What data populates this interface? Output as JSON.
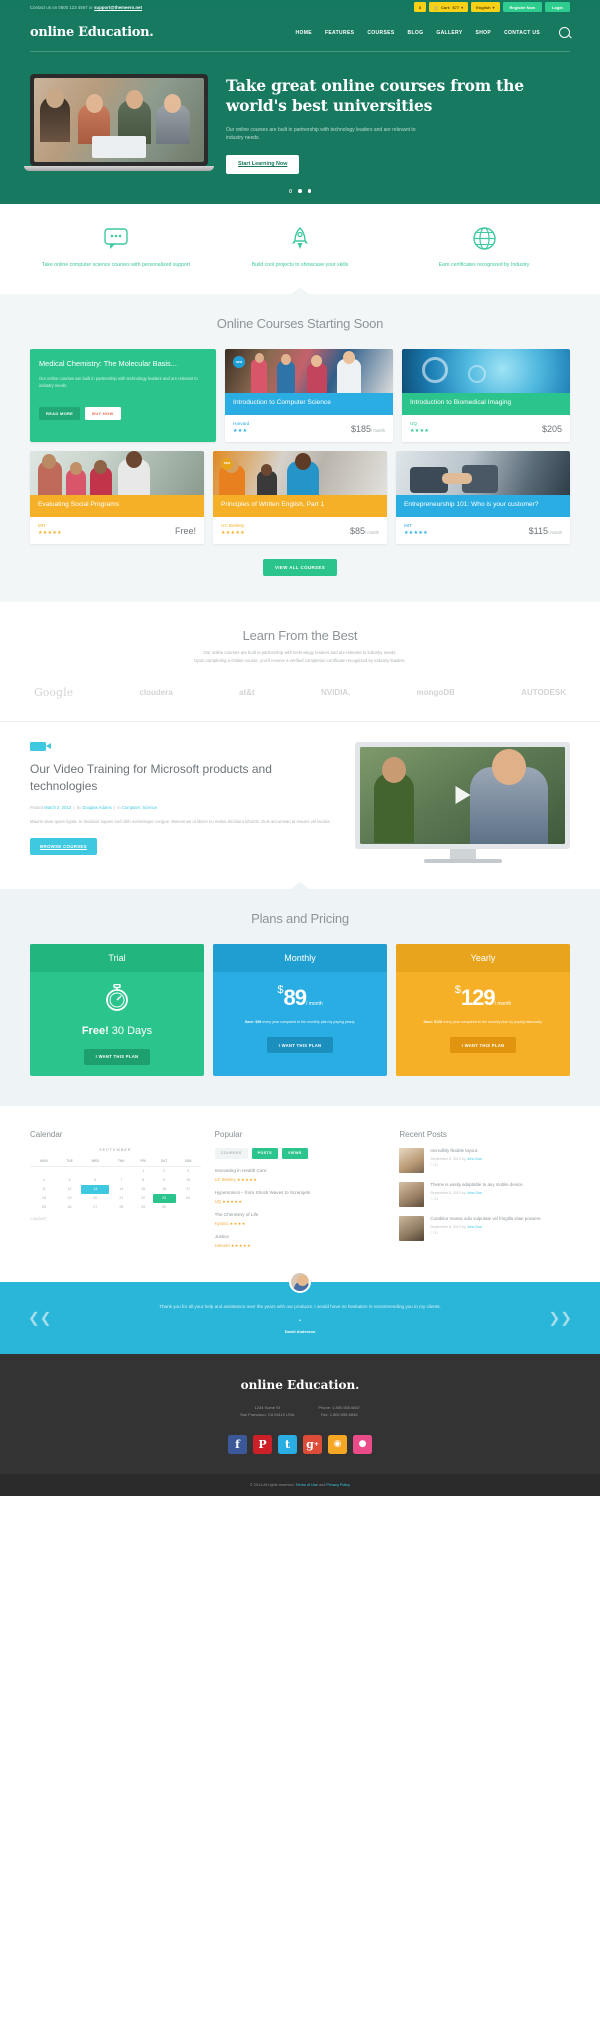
{
  "topbar": {
    "contact_prefix": "Contact us on 0800 123 4567 or",
    "contact_email": "support@themeero.net",
    "currency": "$",
    "cart_label": "Cart:",
    "cart_amount": "$77",
    "language": "English",
    "register": "Register Now",
    "login": "Login"
  },
  "header": {
    "logo": "online Education.",
    "nav": [
      "HOME",
      "FEATURES",
      "COURSES",
      "BLOG",
      "GALLERY",
      "SHOP",
      "CONTACT US"
    ],
    "search_icon": "search-icon"
  },
  "hero": {
    "heading": "Take great online courses from the world's best universities",
    "paragraph": "Our online courses are built in partnership with technology leaders and are relevant to industry needs.",
    "cta": "Start Learning Now",
    "slide_count": 3,
    "active_slide": 1
  },
  "features": [
    {
      "icon": "chat-bubble-icon",
      "text": "Take online computer science courses with personalized support"
    },
    {
      "icon": "rocket-icon",
      "text": "Build cool projects to showcase your skills"
    },
    {
      "icon": "globe-icon",
      "text": "Earn certificates recognized by Industry"
    }
  ],
  "courses": {
    "title": "Online Courses Starting Soon",
    "promo": {
      "title": "Medical Chemistry: The Molecular Basis...",
      "body": "Our online courses are built in partnership with technology leaders and are relevant to industry needs.",
      "btn_read": "READ MORE",
      "btn_buy": "BUY NOW"
    },
    "items": [
      {
        "title": "Introduction to Computer Science",
        "university": "Harvard",
        "rating": 3,
        "price": "$185",
        "per": "/ month",
        "color": "#29ade3",
        "badge": "NEW",
        "badge_color": "#1f9fd6",
        "img": "students-reading"
      },
      {
        "title": "Introduction to Biomedical Imaging",
        "university": "UQ",
        "rating": 4,
        "price": "$205",
        "per": "",
        "color": "#2bc48c",
        "badge": "",
        "badge_color": "",
        "img": "microscope-blue"
      },
      {
        "title": "Evaluating Social Programs",
        "university": "MIT",
        "rating": 5,
        "price": "Free!",
        "per": "",
        "color": "#f5b027",
        "badge": "",
        "badge_color": "",
        "img": "family-group"
      },
      {
        "title": "Principles of Written English, Part 1",
        "university": "UC Berkley",
        "rating": 5,
        "price": "$85",
        "per": "/ month",
        "color": "#f5b027",
        "badge": "NEW",
        "badge_color": "#e8a21c",
        "img": "classroom-orange"
      },
      {
        "title": "Entrepreneurship 101: Who is your customer?",
        "university": "MIT",
        "rating": 5,
        "price": "$115",
        "per": "/ month",
        "color": "#29ade3",
        "badge": "",
        "badge_color": "",
        "img": "handshake"
      }
    ],
    "view_all": "VIEW ALL COURSES"
  },
  "learn": {
    "title": "Learn From the Best",
    "line1": "Our online courses are built in partnership with technology leaders and are relevant to industry needs.",
    "line2": "Upon completing a Online course, you'll receive a verified completion certificate recognized by industry leaders.",
    "logos": [
      "Google",
      "cloudera",
      "at&t",
      "NVIDIA.",
      "mongoDB",
      "AUTODESK"
    ]
  },
  "video": {
    "icon": "video-camera-icon",
    "heading": "Our Video Training for Microsoft products and technologies",
    "meta_posted": "Posted",
    "meta_date": "March 2, 2013",
    "meta_by": "by",
    "meta_author": "Douglas Adams",
    "meta_in": "in",
    "meta_cat": "Computer, Science",
    "body": "Mauris vitae quam ligula. In tincidunt sapien sed nibh scelerisque congue. Maecenas ut libero eu metus tincidunt lobortis. Duis accumsan at mauris vel lacinia.",
    "cta": "BROWSE COURSES",
    "play_icon": "play-icon"
  },
  "pricing": {
    "title": "Plans and Pricing",
    "plans": [
      {
        "name": "Trial",
        "header_color": "#23b57e",
        "body_color": "#2bc48c",
        "icon": "stopwatch-icon",
        "price": "",
        "currency": "",
        "per": "",
        "headline_bold": "Free!",
        "headline_rest": "30 Days",
        "note": "",
        "note_bold": "",
        "btn": "I WANT THIS PLAN",
        "btn_color": "#1da06e"
      },
      {
        "name": "Monthly",
        "header_color": "#1f9fd1",
        "body_color": "#29ade3",
        "icon": "",
        "price": "89",
        "currency": "$",
        "per": "/ month",
        "headline_bold": "",
        "headline_rest": "",
        "note_bold": "Save: $98",
        "note": "every year compared to the monthly plan by paying yearly.",
        "btn": "I WANT THIS PLAN",
        "btn_color": "#1b8fbd"
      },
      {
        "name": "Yearly",
        "header_color": "#e8a41c",
        "body_color": "#f5b027",
        "icon": "",
        "price": "129",
        "currency": "$",
        "per": "/ month",
        "headline_bold": "",
        "headline_rest": "",
        "note_bold": "Save: $128",
        "note": "every year compared to the monthly plan by paying biannually.",
        "btn": "I WANT THIS PLAN",
        "btn_color": "#e09410"
      }
    ]
  },
  "calendar": {
    "title": "Calendar",
    "month": "SEPTEMBER",
    "weekdays": [
      "MON",
      "TUE",
      "WED",
      "THU",
      "FRI",
      "SAT",
      "SUN"
    ],
    "weeks": [
      [
        "",
        "",
        "",
        "",
        "1",
        "2",
        "3"
      ],
      [
        "4",
        "5",
        "6",
        "7",
        "8",
        "9",
        "10"
      ],
      [
        "11",
        "12",
        "13",
        "14",
        "15",
        "16",
        "17"
      ],
      [
        "18",
        "19",
        "20",
        "21",
        "22",
        "23",
        "24"
      ],
      [
        "25",
        "26",
        "27",
        "28",
        "29",
        "30",
        ""
      ]
    ],
    "highlight_blue": "13",
    "highlight_green": "23",
    "prev_link": "« AUGUST"
  },
  "popular": {
    "title": "Popular",
    "tabs": [
      {
        "label": "COURSES",
        "active": false
      },
      {
        "label": "POSTS",
        "active": true
      },
      {
        "label": "VIEWS",
        "active": false
      }
    ],
    "items": [
      {
        "title": "Innovating in Health Care",
        "source": "UC Berkley",
        "rating": 5
      },
      {
        "title": "Hypersonics – from Shock Waves to Scramjets",
        "source": "UQ",
        "rating": 5
      },
      {
        "title": "The Chemistry of Life",
        "source": "KyotoU",
        "rating": 4
      },
      {
        "title": "Justice",
        "source": "Harvard",
        "rating": 5
      }
    ]
  },
  "recent_posts": {
    "title": "Recent Posts",
    "items": [
      {
        "title": "Incredibly flexible layout.",
        "date": "September 8, 2013",
        "by": "by",
        "author": "John Doe",
        "comments": "31"
      },
      {
        "title": "Theme is easily adaptable to any mobile device.",
        "date": "September 8, 2013",
        "by": "by",
        "author": "John Doe",
        "comments": "31"
      },
      {
        "title": "Curabitur massa odio vulputate vel fringilla vitae posuere.",
        "date": "September 8, 2013",
        "by": "by",
        "author": "John Doe",
        "comments": "31"
      }
    ]
  },
  "testimonial": {
    "quote": "Thank you for all your help and assistance over the years with our products. I would have no hesitation in recommending you to my clients.",
    "name": "David Anderson",
    "prev_icon": "chevron-left-icon",
    "next_icon": "chevron-right-icon",
    "avatar": "avatar"
  },
  "footer": {
    "logo": "online Education.",
    "address_line1": "1234 Some St",
    "address_line2": "San Francisco, CA 94110 USA",
    "phone_line1": "Phone: 1.800.555.6847",
    "phone_line2": "Fax: 1.800.555.6846",
    "socials": [
      {
        "name": "facebook-icon",
        "glyph": "f",
        "color": "#3b5998"
      },
      {
        "name": "pinterest-icon",
        "glyph": "P",
        "color": "#cb2027"
      },
      {
        "name": "twitter-icon",
        "glyph": "t",
        "color": "#29ade3"
      },
      {
        "name": "google-plus-icon",
        "glyph": "g",
        "color": "#dd4b39"
      },
      {
        "name": "rss-icon",
        "glyph": "◉",
        "color": "#f5a623"
      },
      {
        "name": "dribbble-icon",
        "glyph": "●",
        "color": "#ea4c89"
      }
    ],
    "copyright": "© 2014 All rights reserved.",
    "terms": "Terms of Use",
    "and": "and",
    "privacy": "Privacy Policy"
  },
  "colors": {
    "green_dark": "#17795f",
    "green": "#2bc48c",
    "blue": "#29ade3",
    "yellow": "#f5b027",
    "teal": "#29b6d8"
  }
}
